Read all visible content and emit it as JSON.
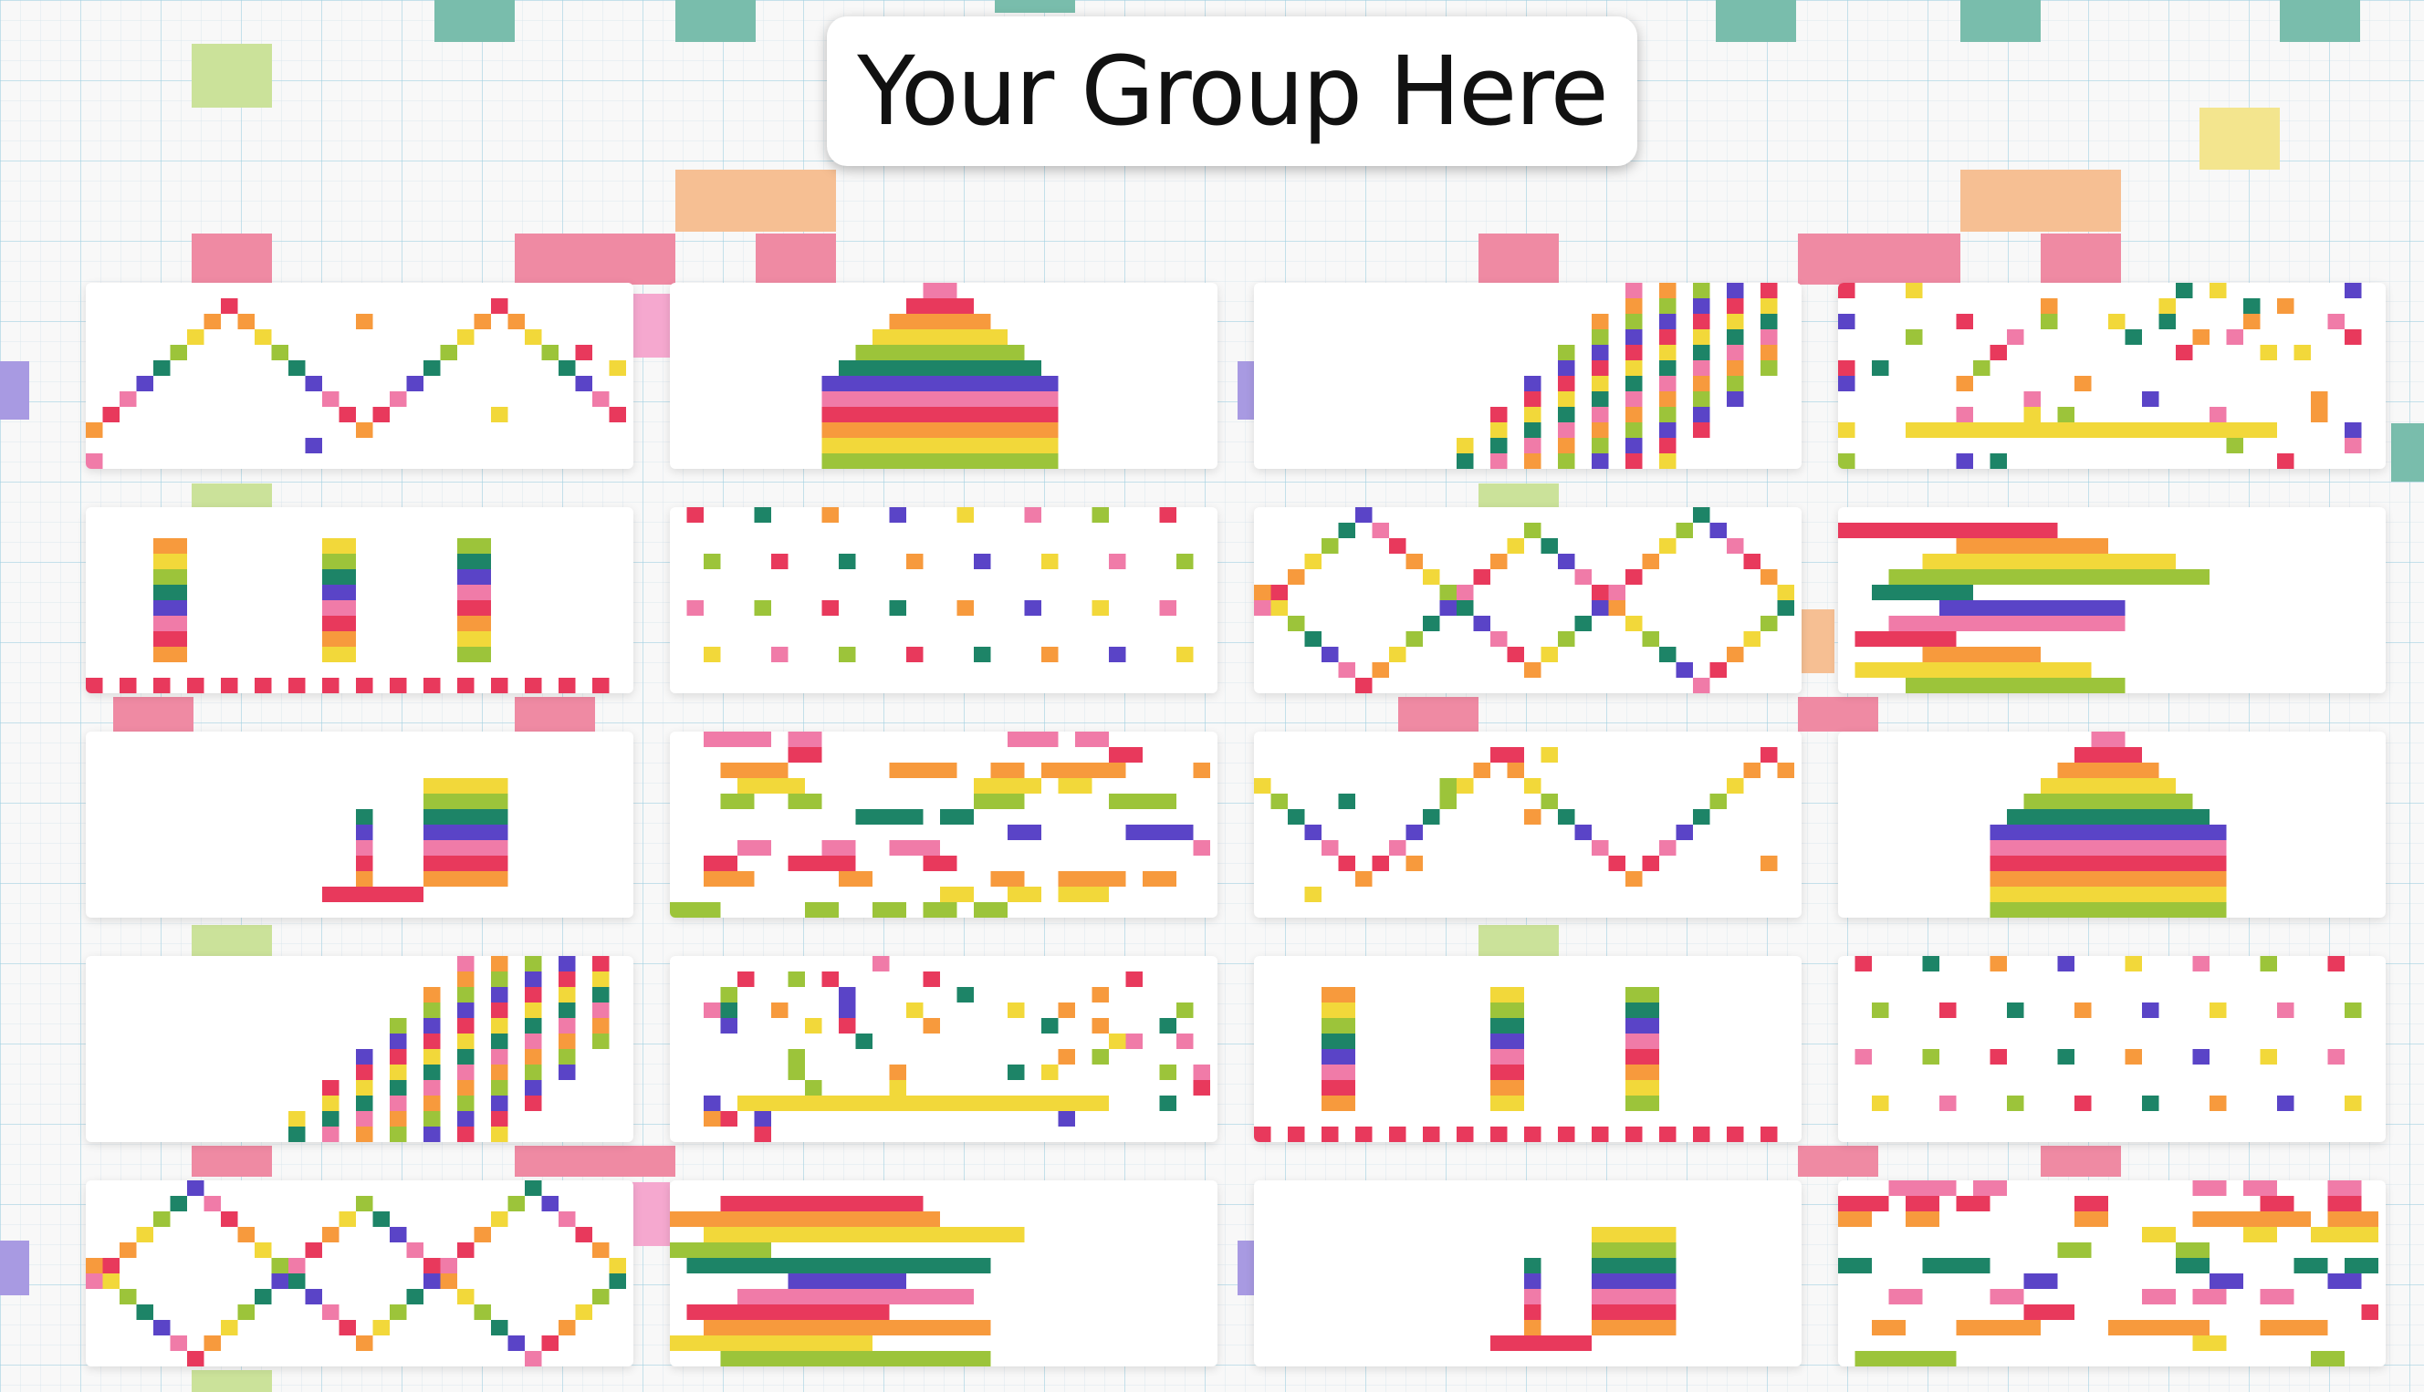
{
  "page": {
    "title": "Your Group Here"
  },
  "colors": {
    "pink": "#f07ba8",
    "red": "#e8395c",
    "orange": "#f79a3d",
    "yellow": "#f2d83a",
    "lime": "#9cc43a",
    "green": "#1d8467",
    "purple": "#5a44c7",
    "bg_teal": "#79bdac",
    "bg_lime": "#cbe29a",
    "bg_peach": "#f6bf93",
    "bg_pink": "#ef8aa3",
    "bg_yellow": "#f3e58e",
    "bg_lavender": "#a89ae2"
  },
  "projects": [
    {
      "id": "project-1"
    },
    {
      "id": "project-2"
    },
    {
      "id": "project-3"
    },
    {
      "id": "project-4"
    },
    {
      "id": "project-5"
    },
    {
      "id": "project-6"
    },
    {
      "id": "project-7"
    },
    {
      "id": "project-8"
    },
    {
      "id": "project-9"
    },
    {
      "id": "project-10"
    },
    {
      "id": "project-11"
    },
    {
      "id": "project-12"
    },
    {
      "id": "project-13"
    },
    {
      "id": "project-14"
    },
    {
      "id": "project-15"
    },
    {
      "id": "project-16"
    },
    {
      "id": "project-17"
    },
    {
      "id": "project-18"
    },
    {
      "id": "project-19"
    },
    {
      "id": "project-20"
    }
  ]
}
